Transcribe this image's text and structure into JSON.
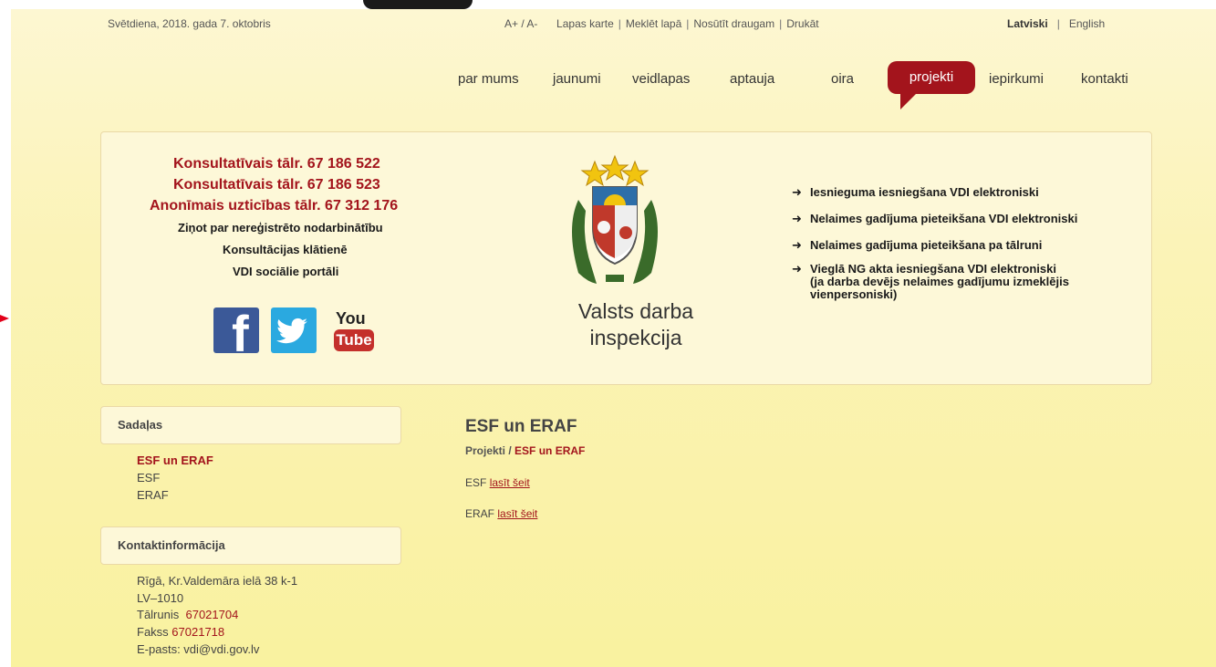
{
  "topbar": {
    "date": "Svētdiena, 2018. gada 7. oktobris",
    "tools": [
      "A+ / A-",
      "Lapas karte",
      "Meklēt lapā",
      "Nosūtīt draugam",
      "Drukāt"
    ],
    "languages": [
      "Latviski",
      "English"
    ]
  },
  "nav": {
    "items": [
      "par mums",
      "jaunumi",
      "veidlapas",
      "aptauja",
      "oira",
      "projekti",
      "iepirkumi",
      "kontakti"
    ],
    "active_index": 5
  },
  "banner": {
    "phones": [
      "Konsultatīvais tālr. 67 186 522",
      "Konsultatīvais tālr. 67 186 523",
      "Anonīmais uzticības tālr. 67 312 176"
    ],
    "links_left": [
      "Ziņot par nereģistrēto nodarbinātību",
      "Konsultācijas klātienē",
      "VDI sociālie portāli"
    ],
    "social": {
      "facebook": "f",
      "youtube_top": "You",
      "youtube_bottom": "Tube"
    },
    "logo_text_1": "Valsts darba",
    "logo_text_2": "inspekcija",
    "links_right": [
      "Iesnieguma iesniegšana VDI elektroniski",
      "Nelaimes gadījuma pieteikšana VDI elektroniski",
      "Nelaimes gadījuma pieteikšana pa tālruni",
      "Vieglā NG akta iesniegšana VDI elektroniski",
      "(ja darba devējs nelaimes gadījumu izmeklējis",
      "vienpersoniski)"
    ]
  },
  "sidebar": {
    "sections_title": "Sadaļas",
    "sections": [
      "ESF un ERAF",
      "ESF",
      "ERAF"
    ],
    "contact_title": "Kontaktinformācija",
    "address": "Rīgā, Kr.Valdemāra ielā 38 k-1",
    "postal": "LV–1010",
    "phone_label": "Tālrunis",
    "phone": "67021704",
    "fax_label": "Fakss",
    "fax": "67021718",
    "email": "E-pasts: vdi@vdi.gov.lv"
  },
  "content": {
    "title": "ESF un ERAF",
    "breadcrumb_parent": "Projekti",
    "breadcrumb_sep": "/",
    "breadcrumb_current": "ESF un ERAF",
    "esf_label": "ESF",
    "esf_link": "lasīt šeit",
    "eraf_label": "ERAF",
    "eraf_link": "lasīt šeit"
  },
  "colors": {
    "accent": "#a3141c",
    "background": "#f9f29f"
  }
}
